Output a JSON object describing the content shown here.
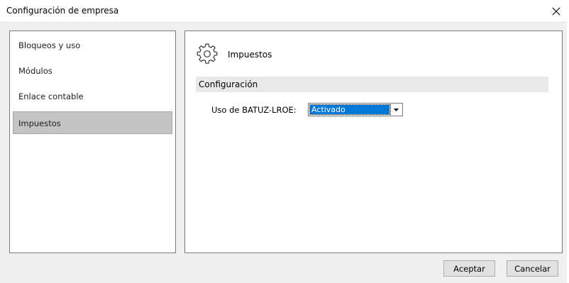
{
  "window": {
    "title": "Configuración de empresa"
  },
  "nav": {
    "items": [
      {
        "label": "Bloqueos y uso",
        "selected": false
      },
      {
        "label": "Módulos",
        "selected": false
      },
      {
        "label": "Enlace contable",
        "selected": false
      },
      {
        "label": "Impuestos",
        "selected": true
      }
    ]
  },
  "content": {
    "icon": "gear-icon",
    "title": "Impuestos",
    "section_header": "Configuración",
    "field": {
      "label": "Uso de BATUZ-LROE:",
      "value": "Activado"
    }
  },
  "footer": {
    "accept_label": "Aceptar",
    "cancel_label": "Cancelar"
  },
  "colors": {
    "selection": "#0078d7",
    "nav_selected": "#c4c4c4",
    "section_header_bg": "#e9e9e9"
  }
}
